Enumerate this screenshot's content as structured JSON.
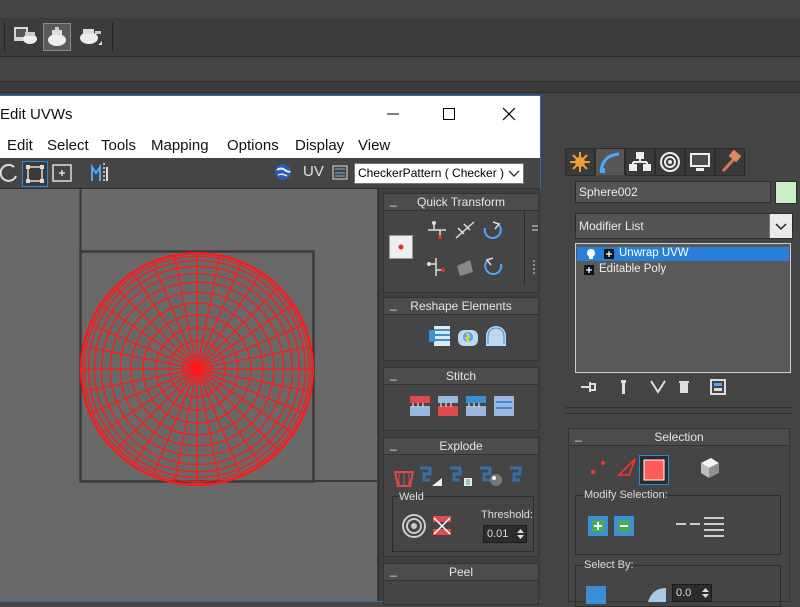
{
  "window": {
    "title": "Edit UVWs",
    "menu": [
      "Edit",
      "Select",
      "Tools",
      "Mapping",
      "Options",
      "Display",
      "View"
    ]
  },
  "uv_toolbar": {
    "uv_label": "UV",
    "texture_dropdown": "CheckerPattern  ( Checker )"
  },
  "rollouts": {
    "quick_transform": "Quick Transform",
    "reshape": "Reshape Elements",
    "stitch": "Stitch",
    "explode": "Explode",
    "weld_label": "Weld",
    "threshold_label": "Threshold:",
    "threshold_value": "0.01",
    "peel": "Peel",
    "collapse": "_"
  },
  "command_panel": {
    "object_name": "Sphere002",
    "modifier_list": "Modifier List",
    "stack": [
      {
        "label": "Unwrap UVW",
        "selected": true
      },
      {
        "label": "Editable Poly",
        "selected": false
      }
    ],
    "selection_title": "Selection",
    "modify_selection": "Modify Selection:",
    "select_by": "Select By:",
    "select_by_value": "0.0"
  },
  "colors": {
    "uv_mesh": "#ff1a1a",
    "viewport_bg": "#696969",
    "selected_stack": "#2a80d8",
    "window_border": "#1f6ec4"
  }
}
